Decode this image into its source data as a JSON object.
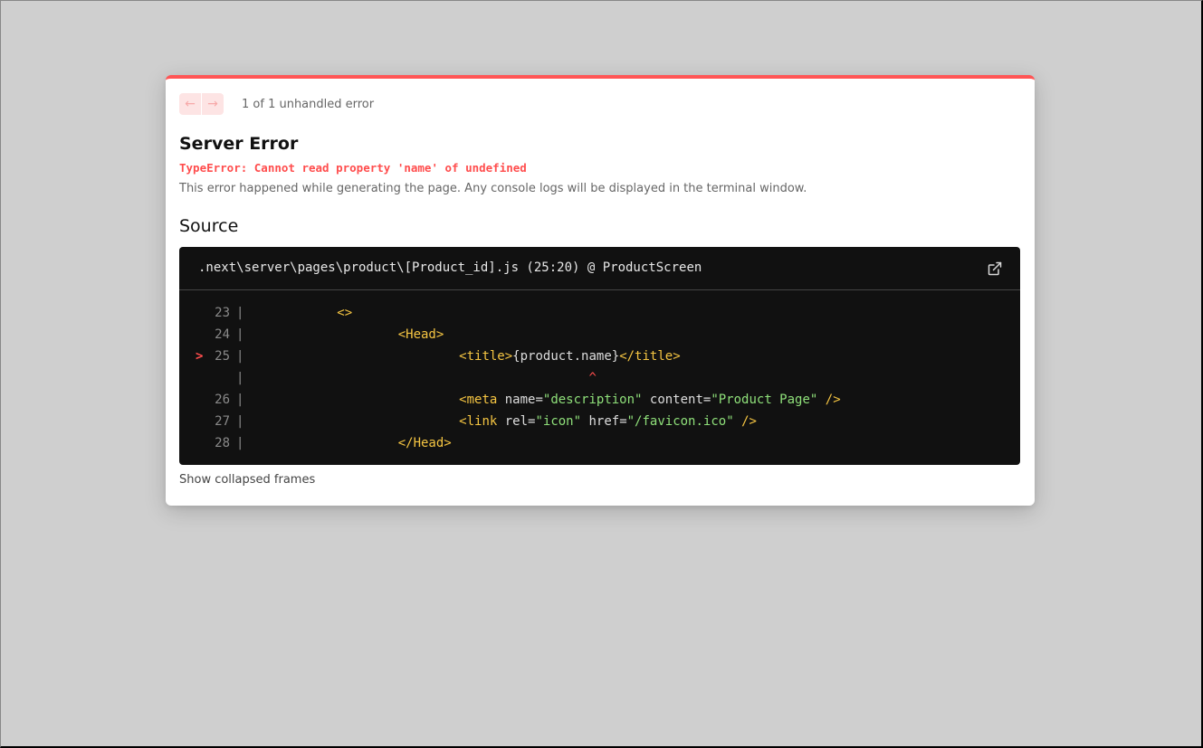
{
  "nav": {
    "prev_icon": "←",
    "next_icon": "→",
    "pagination": "1 of 1 unhandled error"
  },
  "error": {
    "title": "Server Error",
    "message": "TypeError: Cannot read property 'name' of undefined",
    "description": "This error happened while generating the page. Any console logs will be displayed in the terminal window."
  },
  "source": {
    "heading": "Source",
    "file_path": ".next\\server\\pages\\product\\[Product_id].js (25:20) @ ProductScreen",
    "open_icon": "external-link-icon",
    "lines": [
      {
        "marker": "",
        "num": "23",
        "gutter": "|",
        "tokens": [
          {
            "t": "tag",
            "v": "<>"
          }
        ],
        "indent": "          "
      },
      {
        "marker": "",
        "num": "24",
        "gutter": "|",
        "tokens": [
          {
            "t": "tag",
            "v": "<Head>"
          }
        ],
        "indent": "                  "
      },
      {
        "marker": ">",
        "num": "25",
        "gutter": "|",
        "tokens": [
          {
            "t": "tag",
            "v": "<title>"
          },
          {
            "t": "attr",
            "v": "{product.name}"
          },
          {
            "t": "tag",
            "v": "</title>"
          }
        ],
        "indent": "                          "
      },
      {
        "marker": "",
        "num": "",
        "gutter": "|",
        "tokens": [
          {
            "t": "caret",
            "v": "^"
          }
        ],
        "indent": "                                           "
      },
      {
        "marker": "",
        "num": "26",
        "gutter": "|",
        "tokens": [
          {
            "t": "tag",
            "v": "<meta"
          },
          {
            "t": "attr",
            "v": " name="
          },
          {
            "t": "str",
            "v": "\"description\""
          },
          {
            "t": "attr",
            "v": " content="
          },
          {
            "t": "str",
            "v": "\"Product Page\""
          },
          {
            "t": "tag",
            "v": " />"
          }
        ],
        "indent": "                          "
      },
      {
        "marker": "",
        "num": "27",
        "gutter": "|",
        "tokens": [
          {
            "t": "tag",
            "v": "<link"
          },
          {
            "t": "attr",
            "v": " rel="
          },
          {
            "t": "str",
            "v": "\"icon\""
          },
          {
            "t": "attr",
            "v": " href="
          },
          {
            "t": "str",
            "v": "\"/favicon.ico\""
          },
          {
            "t": "tag",
            "v": " />"
          }
        ],
        "indent": "                          "
      },
      {
        "marker": "",
        "num": "28",
        "gutter": "|",
        "tokens": [
          {
            "t": "tag",
            "v": "</Head>"
          }
        ],
        "indent": "                  "
      }
    ]
  },
  "footer": {
    "collapsed_label": "Show collapsed frames"
  },
  "colors": {
    "accent": "#ff5555",
    "error_text": "#ff4d4d",
    "code_bg": "#111111",
    "tag": "#f5c542",
    "string": "#8fe07a"
  }
}
